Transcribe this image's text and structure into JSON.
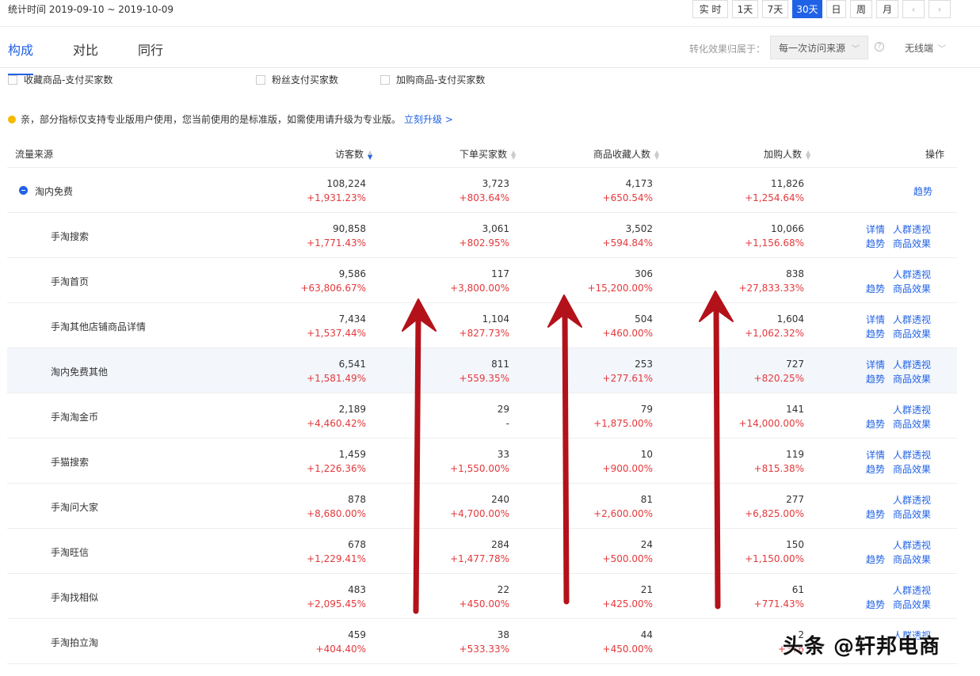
{
  "header": {
    "stat_range": "统计时间 2019-09-10 ~ 2019-10-09",
    "range_buttons": [
      "实 时",
      "1天",
      "7天",
      "30天",
      "日",
      "周",
      "月"
    ],
    "active_range": "30天",
    "prev_icon": "chevron-left-icon",
    "next_icon": "chevron-right-icon"
  },
  "tabs": [
    "构成",
    "对比",
    "同行"
  ],
  "active_tab": "构成",
  "attribution": {
    "label": "转化效果归属于：",
    "value": "每一次访问来源",
    "device": "无线端"
  },
  "checkboxes": [
    "收藏商品-支付买家数",
    "粉丝支付买家数",
    "加购商品-支付买家数"
  ],
  "notice": {
    "text": "亲，部分指标仅支持专业版用户使用，您当前使用的是标准版，如需使用请升级为专业版。",
    "link": "立刻升级 >"
  },
  "table": {
    "headers": {
      "source": "流量来源",
      "visitors": "访客数",
      "orders": "下单买家数",
      "favorites": "商品收藏人数",
      "carts": "加购人数",
      "ops": "操作"
    },
    "rows": [
      {
        "name": "淘内免费",
        "parent": true,
        "visitors": "108,224",
        "visitors_chg": "+1,931.23%",
        "orders": "3,723",
        "orders_chg": "+803.64%",
        "favorites": "4,173",
        "favorites_chg": "+650.54%",
        "carts": "11,826",
        "carts_chg": "+1,254.64%",
        "ops": [
          "趋势"
        ]
      },
      {
        "name": "手淘搜索",
        "visitors": "90,858",
        "visitors_chg": "+1,771.43%",
        "orders": "3,061",
        "orders_chg": "+802.95%",
        "favorites": "3,502",
        "favorites_chg": "+594.84%",
        "carts": "10,066",
        "carts_chg": "+1,156.68%",
        "ops": [
          "详情",
          "人群透视",
          "趋势",
          "商品效果"
        ]
      },
      {
        "name": "手淘首页",
        "visitors": "9,586",
        "visitors_chg": "+63,806.67%",
        "orders": "117",
        "orders_chg": "+3,800.00%",
        "favorites": "306",
        "favorites_chg": "+15,200.00%",
        "carts": "838",
        "carts_chg": "+27,833.33%",
        "ops": [
          "",
          "人群透视",
          "趋势",
          "商品效果"
        ]
      },
      {
        "name": "手淘其他店铺商品详情",
        "visitors": "7,434",
        "visitors_chg": "+1,537.44%",
        "orders": "1,104",
        "orders_chg": "+827.73%",
        "favorites": "504",
        "favorites_chg": "+460.00%",
        "carts": "1,604",
        "carts_chg": "+1,062.32%",
        "ops": [
          "详情",
          "人群透视",
          "趋势",
          "商品效果"
        ]
      },
      {
        "name": "淘内免费其他",
        "highlight": true,
        "visitors": "6,541",
        "visitors_chg": "+1,581.49%",
        "orders": "811",
        "orders_chg": "+559.35%",
        "favorites": "253",
        "favorites_chg": "+277.61%",
        "carts": "727",
        "carts_chg": "+820.25%",
        "ops": [
          "详情",
          "人群透视",
          "趋势",
          "商品效果"
        ]
      },
      {
        "name": "手淘淘金币",
        "visitors": "2,189",
        "visitors_chg": "+4,460.42%",
        "orders": "29",
        "orders_chg": "-",
        "favorites": "79",
        "favorites_chg": "+1,875.00%",
        "carts": "141",
        "carts_chg": "+14,000.00%",
        "ops": [
          "",
          "人群透视",
          "趋势",
          "商品效果"
        ]
      },
      {
        "name": "手猫搜索",
        "visitors": "1,459",
        "visitors_chg": "+1,226.36%",
        "orders": "33",
        "orders_chg": "+1,550.00%",
        "favorites": "10",
        "favorites_chg": "+900.00%",
        "carts": "119",
        "carts_chg": "+815.38%",
        "ops": [
          "详情",
          "人群透视",
          "趋势",
          "商品效果"
        ]
      },
      {
        "name": "手淘问大家",
        "visitors": "878",
        "visitors_chg": "+8,680.00%",
        "orders": "240",
        "orders_chg": "+4,700.00%",
        "favorites": "81",
        "favorites_chg": "+2,600.00%",
        "carts": "277",
        "carts_chg": "+6,825.00%",
        "ops": [
          "",
          "人群透视",
          "趋势",
          "商品效果"
        ]
      },
      {
        "name": "手淘旺信",
        "visitors": "678",
        "visitors_chg": "+1,229.41%",
        "orders": "284",
        "orders_chg": "+1,477.78%",
        "favorites": "24",
        "favorites_chg": "+500.00%",
        "carts": "150",
        "carts_chg": "+1,150.00%",
        "ops": [
          "",
          "人群透视",
          "趋势",
          "商品效果"
        ]
      },
      {
        "name": "手淘找相似",
        "visitors": "483",
        "visitors_chg": "+2,095.45%",
        "orders": "22",
        "orders_chg": "+450.00%",
        "favorites": "21",
        "favorites_chg": "+425.00%",
        "carts": "61",
        "carts_chg": "+771.43%",
        "ops": [
          "",
          "人群透视",
          "趋势",
          "商品效果"
        ]
      },
      {
        "name": "手淘拍立淘",
        "visitors": "459",
        "visitors_chg": "+404.40%",
        "orders": "38",
        "orders_chg": "+533.33%",
        "favorites": "44",
        "favorites_chg": "+450.00%",
        "carts": "2",
        "carts_chg": "+376",
        "ops": [
          "",
          "人群透视",
          "",
          ""
        ]
      }
    ]
  },
  "watermark": "头条 @轩邦电商",
  "colors": {
    "accent": "#2062e6",
    "increase": "#e4393c",
    "arrow": "#b3121a",
    "highlight_row": "#f3f6fb"
  }
}
